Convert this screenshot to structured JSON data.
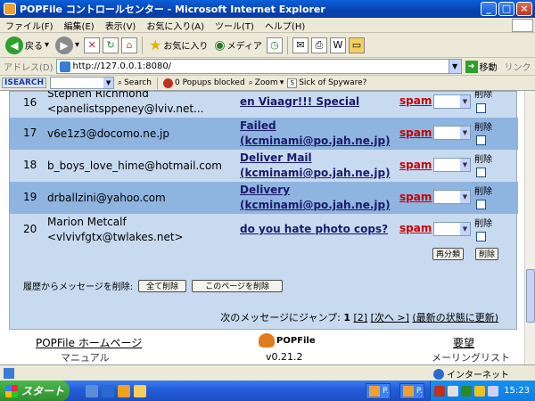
{
  "window": {
    "title": "POPFile コントロールセンター - Microsoft Internet Explorer",
    "min": "_",
    "max": "□",
    "close": "×"
  },
  "menu": {
    "items": [
      "ファイル(F)",
      "編集(E)",
      "表示(V)",
      "お気に入り(A)",
      "ツール(T)",
      "ヘルプ(H)"
    ]
  },
  "toolbar": {
    "back_label": "戻る",
    "favorites_label": "お気に入り",
    "media_label": "メディア"
  },
  "address": {
    "label": "アドレス(D)",
    "url": "http://127.0.0.1:8080/",
    "go_label": "移動",
    "links_label": "リンク"
  },
  "isearch_bar": {
    "logo": "ISEARCH",
    "search_label": "Search",
    "popups_label": "0 Popups blocked",
    "zoom_label": "Zoom",
    "spyware_label": "Sick of Spyware?"
  },
  "messages": [
    {
      "num": "16",
      "from_line1": "Stephen Richmond",
      "from_line2": "<panelistsppeney@lviv.net...",
      "subject_line1": "en Viaagr!!! Special",
      "subject_line2": "",
      "bucket": "spam",
      "delete_label": "削除"
    },
    {
      "num": "17",
      "from_line1": "v6e1z3@docomo.ne.jp",
      "from_line2": "",
      "subject_line1": "Failed",
      "subject_line2": "(kcminami@po.jah.ne.jp)",
      "bucket": "spam",
      "delete_label": "削除"
    },
    {
      "num": "18",
      "from_line1": "b_boys_love_hime@hotmail.com",
      "from_line2": "",
      "subject_line1": "Deliver Mail",
      "subject_line2": "(kcminami@po.jah.ne.jp)",
      "bucket": "spam",
      "delete_label": "削除"
    },
    {
      "num": "19",
      "from_line1": "drballzini@yahoo.com",
      "from_line2": "",
      "subject_line1": "Delivery",
      "subject_line2": "(kcminami@po.jah.ne.jp)",
      "bucket": "spam",
      "delete_label": "削除"
    },
    {
      "num": "20",
      "from_line1": "Marion Metcalf",
      "from_line2": "<vlvivfgtx@twlakes.net>",
      "subject_line1": "do you hate photo cops?",
      "subject_line2": "",
      "bucket": "spam",
      "delete_label": "削除"
    }
  ],
  "actions": {
    "reclassify_label": "再分類",
    "delete_label": "削除"
  },
  "history": {
    "label": "履歴からメッセージを削除:",
    "delete_all_label": "全て削除",
    "delete_page_label": "このページを削除"
  },
  "jump": {
    "label": "次のメッセージにジャンプ:",
    "page1": "1",
    "page2": "[2]",
    "next": "[次へ >]",
    "refresh": "(最新の状態に更新)"
  },
  "footer": {
    "homepage_label": "POPFile ホームページ",
    "manual_label": "マニュアル",
    "logo_text": "POPFile",
    "version": "v0.21.2",
    "request_label": "要望",
    "mailinglist_label": "メーリングリスト"
  },
  "status": {
    "zone_label": "インターネット"
  },
  "taskbar": {
    "start_label": "スタート",
    "task1_label": "P.",
    "task2_label": "P.",
    "clock": "15:23"
  },
  "colors": {
    "panel": "#c7daf0",
    "row_dark": "#8fb4e0",
    "spam": "#cc0000",
    "title_bar": "#0842b0"
  }
}
